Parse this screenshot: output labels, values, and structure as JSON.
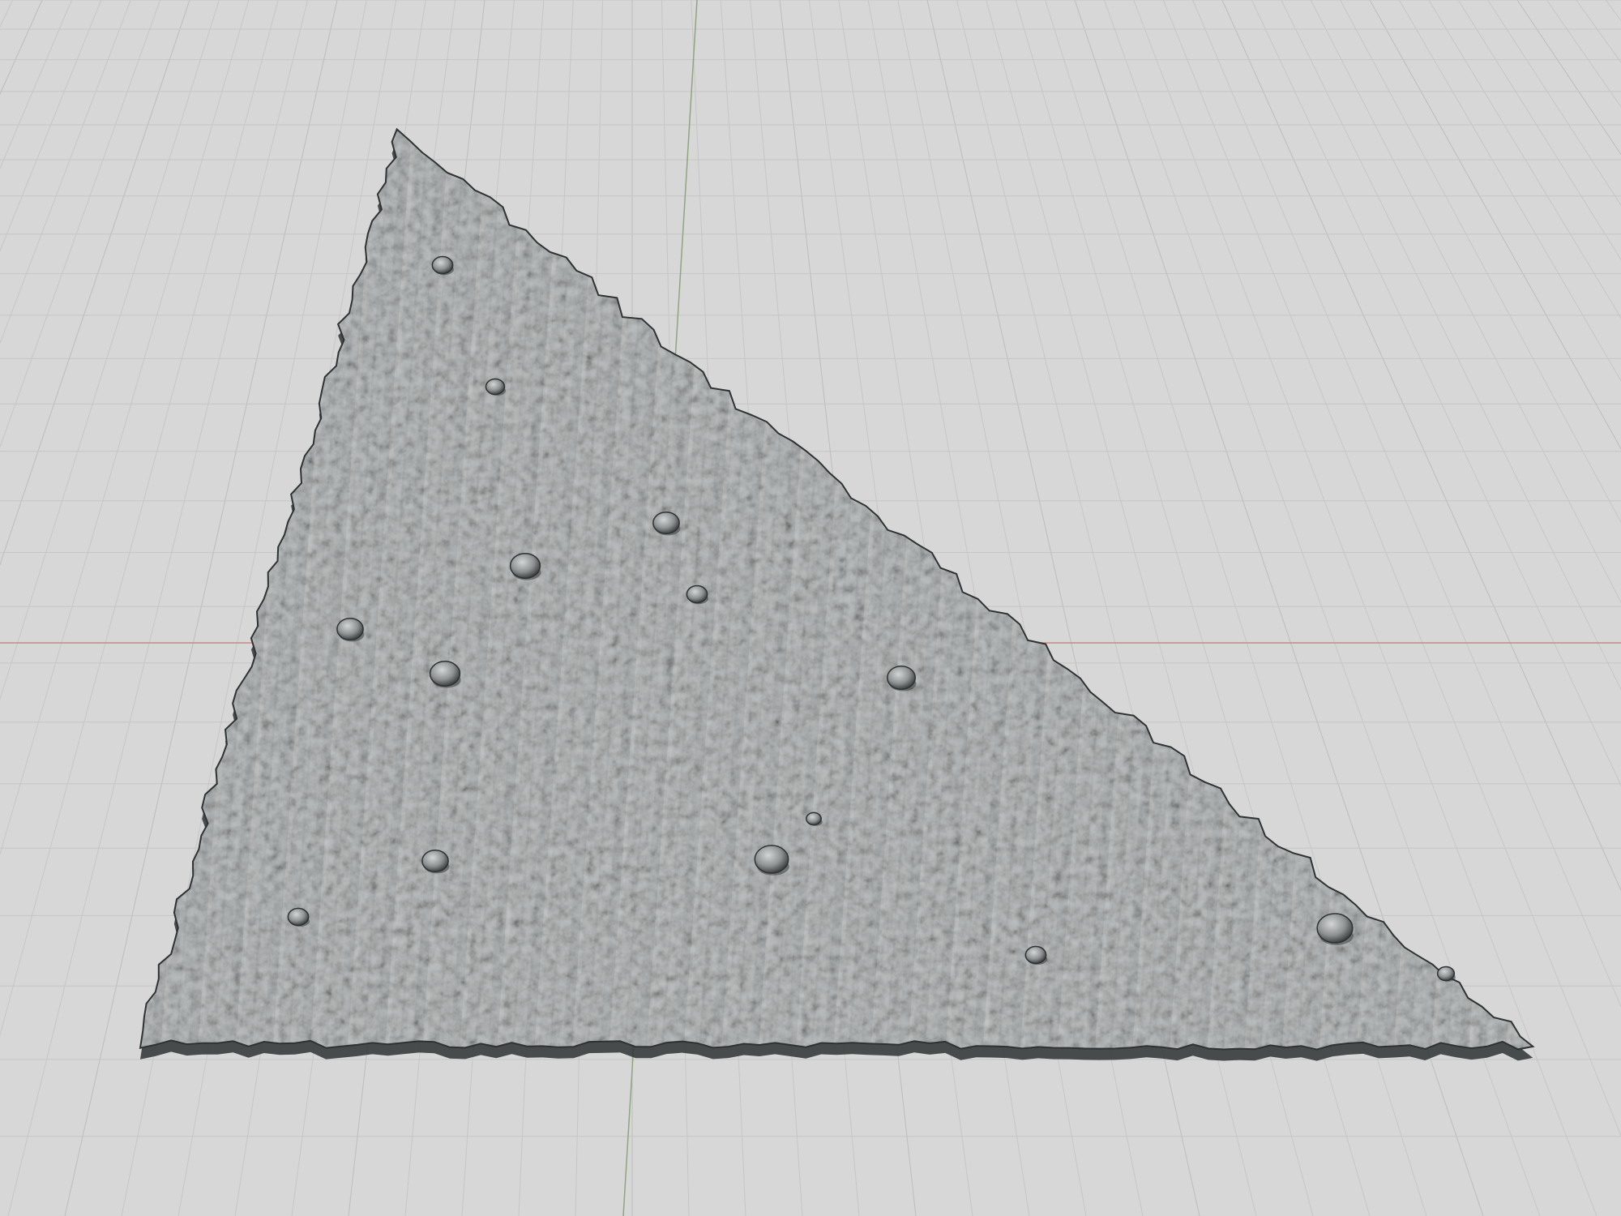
{
  "viewport": {
    "background_color": "#d7d7d7",
    "grid_minor_color": "#c6c6c6",
    "grid_major_color": "#bcbcbc",
    "axis_red_color": "#c28a8a",
    "axis_green_color": "#8fa582"
  },
  "mesh": {
    "shape": "triangular-terrain-slab",
    "surface_color": "#9c9e9e",
    "ridge_color": "#6f7474",
    "highlight_color": "#c5c8c8",
    "shadow_color": "#2e3232",
    "pebble_count": 15
  }
}
